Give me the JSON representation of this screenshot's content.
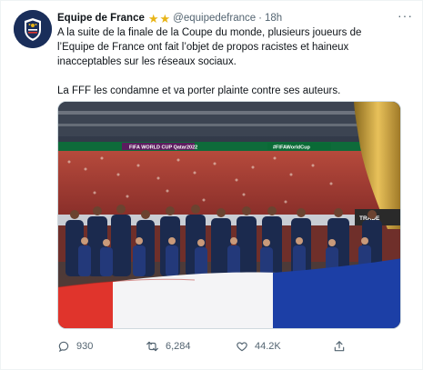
{
  "tweet": {
    "display_name": "Equipe de France",
    "handle": "@equipedefrance",
    "separator": "·",
    "time": "18h",
    "more_label": "···",
    "paragraphs": [
      "A la suite de la finale de la Coupe du monde, plusieurs joueurs de l’Equipe de France ont fait l’objet de propos racistes et haineux inacceptables sur les réseaux sociaux.",
      "La FFF les condamne et va porter plainte contre ses auteurs."
    ],
    "badges": [
      "star-icon",
      "star-icon"
    ],
    "media": {
      "banner_texts": [
        "FIFA WORLD CUP Qatar2022",
        "#FIFAWorldCup",
        "TRADE"
      ]
    },
    "actions": {
      "reply_count": "930",
      "retweet_count": "6,284",
      "like_count": "44.2K"
    }
  },
  "colors": {
    "text": "#0f1419",
    "secondary": "#536471",
    "star": "#e8b416",
    "avatar_bg": "#1a2e5a",
    "flag_blue": "#1c3fa6",
    "flag_red": "#e0342c"
  }
}
